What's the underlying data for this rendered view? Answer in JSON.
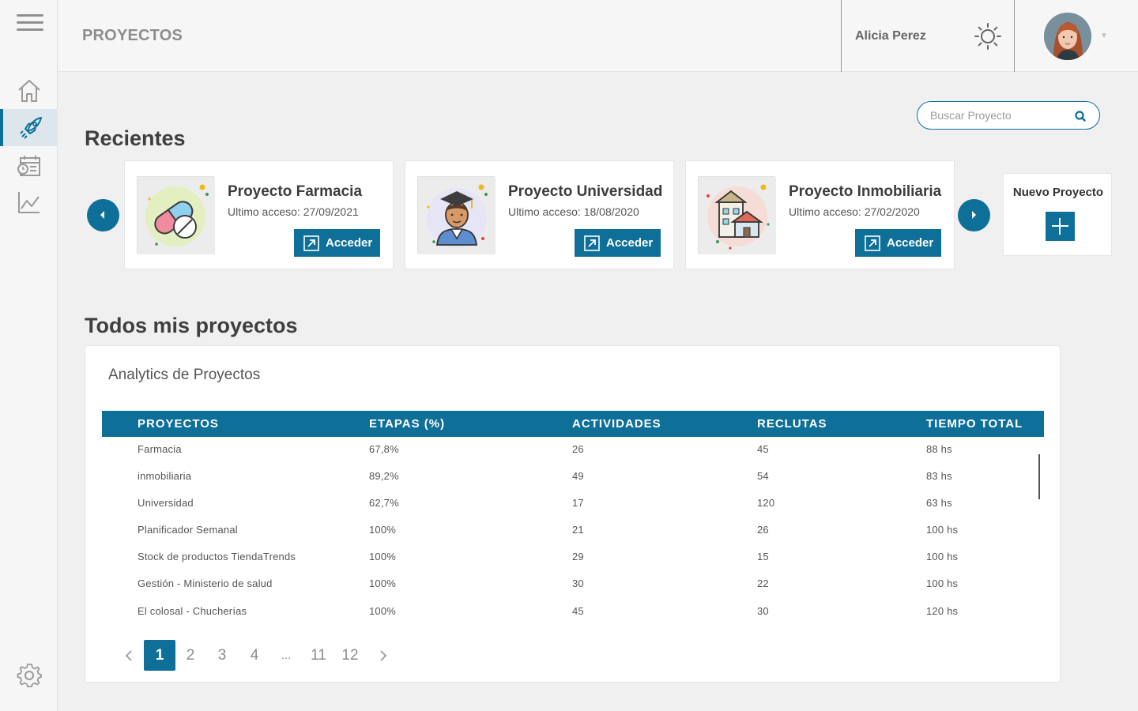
{
  "header": {
    "page_title": "PROYECTOS",
    "user_name": "Alicia Perez"
  },
  "search": {
    "placeholder": "Buscar Proyecto"
  },
  "recent": {
    "title": "Recientes",
    "cards": [
      {
        "title": "Proyecto Farmacia",
        "last_access": "Ultimo acceso: 27/09/2021",
        "button": "Acceder",
        "icon": "pills-icon"
      },
      {
        "title": "Proyecto Universidad",
        "last_access": "Ultimo acceso: 18/08/2020",
        "button": "Acceder",
        "icon": "graduate-icon"
      },
      {
        "title": "Proyecto Inmobiliaria",
        "last_access": "Ultimo acceso: 27/02/2020",
        "button": "Acceder",
        "icon": "buildings-icon"
      }
    ],
    "new_project": "Nuevo Proyecto"
  },
  "all_projects": {
    "title": "Todos mis proyectos",
    "panel_title": "Analytics de Proyectos",
    "columns": [
      "PROYECTOS",
      "ETAPAS (%)",
      "ACTIVIDADES",
      "RECLUTAS",
      "TIEMPO TOTAL"
    ],
    "rows": [
      [
        "Farmacia",
        "67,8%",
        "26",
        "45",
        "88 hs"
      ],
      [
        "inmobiliaria",
        "89,2%",
        "49",
        "54",
        "83 hs"
      ],
      [
        "Universidad",
        "62,7%",
        "17",
        "120",
        "63 hs"
      ],
      [
        "Planificador Semanal",
        "100%",
        "21",
        "26",
        "100 hs"
      ],
      [
        "Stock de productos TiendaTrends",
        "100%",
        "29",
        "15",
        "100 hs"
      ],
      [
        "Gestión - Ministerio de salud",
        "100%",
        "30",
        "22",
        "100 hs"
      ],
      [
        "El colosal - Chucherías",
        "100%",
        "45",
        "30",
        "120 hs"
      ]
    ],
    "pagination": [
      "1",
      "2",
      "3",
      "4",
      "...",
      "11",
      "12"
    ],
    "current_page": "1"
  },
  "colors": {
    "accent": "#0e6f99",
    "background": "#f0f0f0"
  }
}
